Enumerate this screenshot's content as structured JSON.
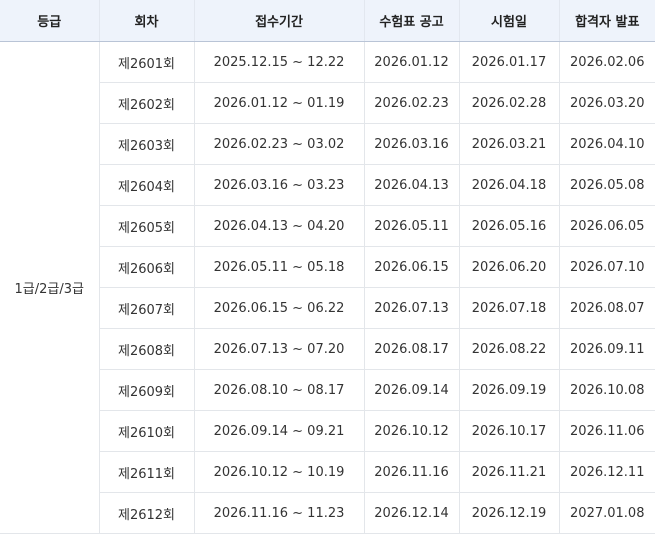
{
  "table": {
    "headers": [
      "등급",
      "회차",
      "접수기간",
      "수험표 공고",
      "시험일",
      "합격자 발표"
    ],
    "grade": "1급/2급/3급",
    "rows": [
      [
        "제2601회",
        "2025.12.15 ~ 12.22",
        "2026.01.12",
        "2026.01.17",
        "2026.02.06"
      ],
      [
        "제2602회",
        "2026.01.12 ~ 01.19",
        "2026.02.23",
        "2026.02.28",
        "2026.03.20"
      ],
      [
        "제2603회",
        "2026.02.23 ~ 03.02",
        "2026.03.16",
        "2026.03.21",
        "2026.04.10"
      ],
      [
        "제2604회",
        "2026.03.16 ~ 03.23",
        "2026.04.13",
        "2026.04.18",
        "2026.05.08"
      ],
      [
        "제2605회",
        "2026.04.13 ~ 04.20",
        "2026.05.11",
        "2026.05.16",
        "2026.06.05"
      ],
      [
        "제2606회",
        "2026.05.11 ~ 05.18",
        "2026.06.15",
        "2026.06.20",
        "2026.07.10"
      ],
      [
        "제2607회",
        "2026.06.15 ~ 06.22",
        "2026.07.13",
        "2026.07.18",
        "2026.08.07"
      ],
      [
        "제2608회",
        "2026.07.13 ~ 07.20",
        "2026.08.17",
        "2026.08.22",
        "2026.09.11"
      ],
      [
        "제2609회",
        "2026.08.10 ~ 08.17",
        "2026.09.14",
        "2026.09.19",
        "2026.10.08"
      ],
      [
        "제2610회",
        "2026.09.14 ~ 09.21",
        "2026.10.12",
        "2026.10.17",
        "2026.11.06"
      ],
      [
        "제2611회",
        "2026.10.12 ~ 10.19",
        "2026.11.16",
        "2026.11.21",
        "2026.12.11"
      ],
      [
        "제2612회",
        "2026.11.16 ~ 11.23",
        "2026.12.14",
        "2026.12.19",
        "2027.01.08"
      ]
    ]
  }
}
